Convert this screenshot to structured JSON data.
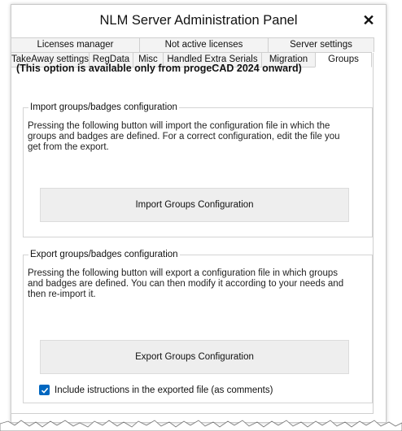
{
  "window": {
    "title": "NLM Server Administration Panel",
    "close_symbol": "✕"
  },
  "tabs": {
    "row1": [
      "Licenses manager",
      "Not active licenses",
      "Server settings"
    ],
    "row2": [
      "TakeAway settings",
      "RegData",
      "Misc",
      "Handled Extra Serials",
      "Migration",
      "Groups"
    ],
    "active": "Groups"
  },
  "notice": "(This option is available only from progeCAD 2024 onward)",
  "import_group": {
    "title": "Import groups/badges configuration",
    "description": "Pressing the following button will import the configuration file in which the groups and badges are defined. For a correct configuration, edit the file you get from the export.",
    "button_label": "Import Groups Configuration"
  },
  "export_group": {
    "title": "Export groups/badges configuration",
    "description": "Pressing the following button will export a configuration file in which groups and badges are defined. You can then modify it according to your needs and then re-import it.",
    "button_label": "Export Groups Configuration",
    "checkbox_label": "Include istructions in the exported file (as comments)",
    "checkbox_checked": true
  },
  "colors": {
    "accent": "#0067c0",
    "button_bg": "#eeeeee",
    "border": "#cfcfcf"
  }
}
